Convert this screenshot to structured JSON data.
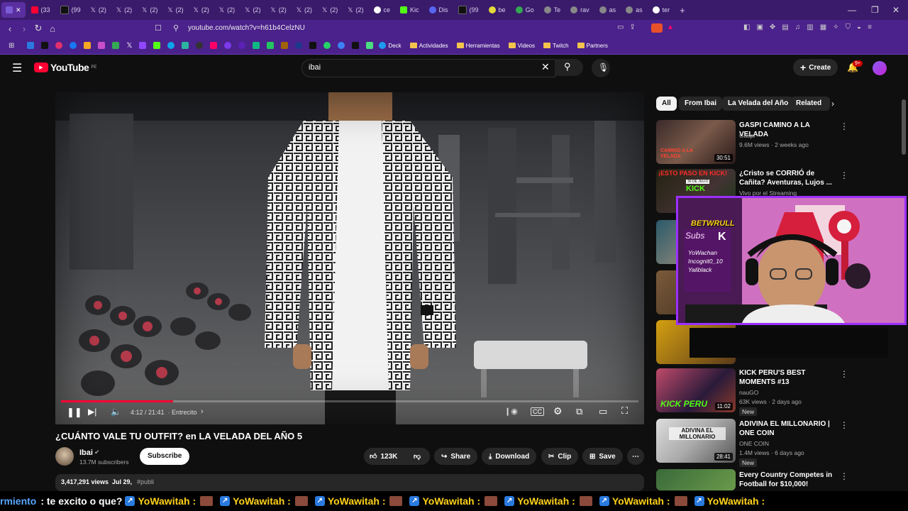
{
  "browser": {
    "tabs": [
      "(33",
      "(99",
      "(2)",
      "(2)",
      "(2)",
      "(2)",
      "(2)",
      "(2)",
      "(2)",
      "(2)",
      "(2)",
      "(2)",
      "(2)",
      "ce",
      "Kic",
      "Dis",
      "(99",
      "be",
      "Go",
      "Te",
      "rav",
      "as",
      "as",
      "ter"
    ],
    "url": "youtube.com/watch?v=h61b4CelzNU",
    "bookmarks": [
      "Deck",
      "Actividades",
      "Herramientas",
      "Videos",
      "Twitch",
      "Partners"
    ]
  },
  "youtube": {
    "logo_text": "YouTube",
    "region": "PE",
    "search_value": "ibai",
    "create_label": "Create",
    "notif_count": "9+"
  },
  "player": {
    "time": "4:12 / 21:41",
    "chapter": "Entrecito",
    "progress": 0.194
  },
  "video": {
    "title": "¿CUÁNTO VALE TU OUTFIT? en LA VELADA DEL AÑO 5",
    "channel": "Ibai",
    "subscribers": "13.7M subscribers",
    "subscribe_label": "Subscribe",
    "likes": "123K",
    "share_label": "Share",
    "download_label": "Download",
    "clip_label": "Clip",
    "save_label": "Save",
    "views": "3,417,291 views",
    "date": "Jul 29,",
    "hashtag": "#publi"
  },
  "chips": [
    "All",
    "From Ibai",
    "La Velada del Año",
    "Related"
  ],
  "recs": [
    {
      "title": "GASPI CAMINO A LA VELADA",
      "channel": "Gaspi",
      "meta": "9.6M views · 2 weeks ago",
      "duration": "30:51"
    },
    {
      "title": "¿Cristo se CORRIÓ de Cañita? Aventuras, Lujos ...",
      "channel": "Vivo por el Streaming",
      "meta": "",
      "duration": ""
    },
    {
      "title": "KICK PERU'S BEST MOMENTS #13",
      "channel": "nauGO",
      "meta": "63K views · 2 days ago",
      "duration": "11:02",
      "badge": "New"
    },
    {
      "title": "ADIVINA EL MILLONARIO | ONE COIN",
      "channel": "ONE COIN",
      "meta": "1.4M views · 6 days ago",
      "duration": "28:41",
      "badge": "New"
    },
    {
      "title": "Every Country Competes in Football for $10,000!",
      "channel": "",
      "meta": "",
      "duration": ""
    }
  ],
  "thumb_texts": {
    "r1": "CAMINO A LA VELADA",
    "r2": "¡ESTO PASO EN KICK!",
    "r2b": "30 DE JULIO",
    "r2c": "KICK",
    "r3": "KICK PERU",
    "r4": "ADIVINA EL MILLONARIO"
  },
  "overlay": {
    "brand": "BETWRULL",
    "subs_label": "Subs",
    "names": [
      "YoWachan",
      "Incognit0_10",
      "Yaliblack"
    ]
  },
  "ticker": {
    "lead": "rmiento",
    "msg": ": te excito o que?",
    "name": "YoWawitah :"
  },
  "colors": {
    "accent_purple": "#4b218b",
    "yt_red": "#ff0033",
    "ticker_blue": "#58a6ff"
  }
}
